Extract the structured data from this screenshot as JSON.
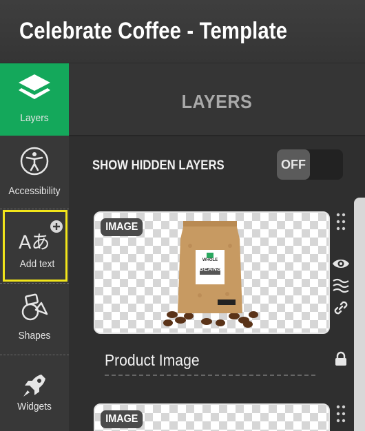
{
  "header": {
    "title": "Celebrate Coffee - Template"
  },
  "sidebar": {
    "items": [
      {
        "label": "Layers",
        "icon": "layers-icon",
        "active": true
      },
      {
        "label": "Accessibility",
        "icon": "accessibility-icon"
      },
      {
        "label": "Add text",
        "icon": "add-text-icon",
        "highlighted": true
      },
      {
        "label": "Shapes",
        "icon": "shapes-icon"
      },
      {
        "label": "Widgets",
        "icon": "rocket-icon"
      }
    ]
  },
  "panel": {
    "title": "LAYERS",
    "show_hidden_label": "SHOW HIDDEN LAYERS",
    "toggle_state": "OFF"
  },
  "layers": [
    {
      "type_badge": "IMAGE",
      "name": "Product Image",
      "locked": true,
      "thumbnail": {
        "bag_label_line1": "WHOLE",
        "bag_label_line2": "BEANS"
      }
    },
    {
      "type_badge": "IMAGE"
    }
  ],
  "colors": {
    "accent": "#14a85b",
    "highlight": "#f2e51a"
  }
}
